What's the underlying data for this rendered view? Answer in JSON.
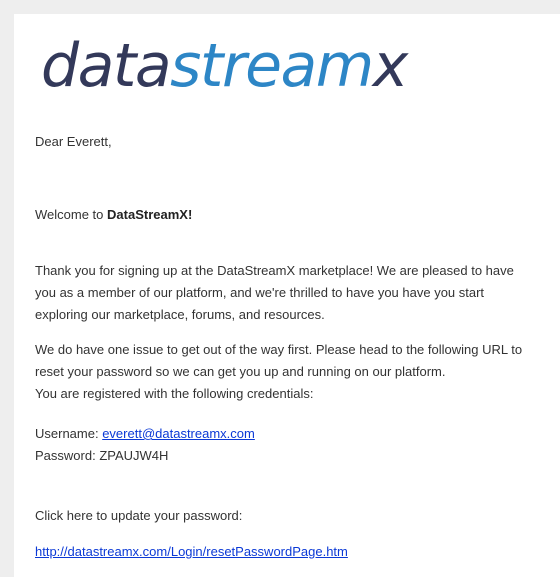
{
  "logo": {
    "part1": "data",
    "part2": "stream",
    "part3": "x"
  },
  "email": {
    "greeting": "Dear Everett,",
    "welcome_prefix": "Welcome to ",
    "welcome_brand": "DataStreamX!",
    "thank_you_lines": [
      "Thank you for signing up at the DataStreamX marketplace! We are pleased to have",
      "you as a member of our platform, and we're thrilled to have you have you start",
      "exploring our marketplace, forums, and resources."
    ],
    "issue_lines": [
      "We do have one issue to get out of the way first. Please head to the following URL to",
      "reset your password so we can get you up and running on our platform.",
      "You are registered with the following credentials:"
    ],
    "username_label": "Username: ",
    "username_value": "everett@datastreamx.com",
    "password_label": "Password: ",
    "password_value": "ZPAUJW4H",
    "click_here_text": "Click here to update your password:",
    "reset_url": "http://datastreamx.com/Login/resetPasswordPage.htm"
  },
  "colors": {
    "logo_dark": "#33395a",
    "logo_accent": "#2d86c6",
    "link": "#0b39d6",
    "text": "#333333",
    "background": "#eeeeee"
  }
}
